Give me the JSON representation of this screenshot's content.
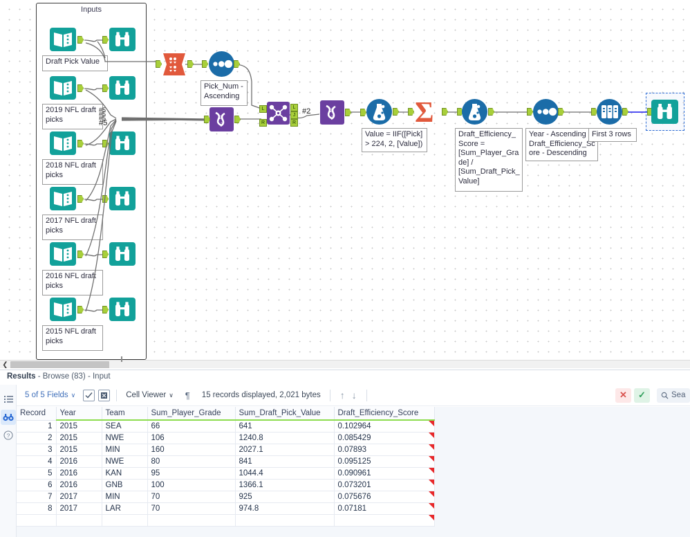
{
  "canvas": {
    "container_title": "Inputs",
    "input_labels": [
      "Draft Pick Value",
      "2019 NFL draft picks",
      "2018 NFL draft picks",
      "2017 NFL draft picks",
      "2016 NFL draft picks",
      "2015 NFL draft picks"
    ],
    "annotations": {
      "sort_pick_num": "Pick_Num - Ascending",
      "formula_value": "Value = IIF([Pick] > 224, 2, [Value])",
      "formula_efficiency": "Draft_Efficiency_Score = [Sum_Player_Grade] / [Sum_Draft_Pick_Value]",
      "sort_year_score": "Year - Ascending\nDraft_Efficiency_Score - Descending",
      "sample_rows": "First 3 rows"
    },
    "connection_labels": {
      "union_multi": "#5",
      "join_out": "#2"
    },
    "join_anchors": [
      "L",
      "J",
      "R"
    ],
    "colors": {
      "input_teal": "#12a19a",
      "browse_teal": "#12a19a",
      "transpose_orange": "#e1593c",
      "sort_blue": "#1b6ca8",
      "join_purple": "#6b3fa0",
      "select_purple": "#6b3fa0",
      "summarize_orange": "#e1593c",
      "formula_blue": "#1b6ca8",
      "sample_blue": "#1b6ca8",
      "anchor_green": "#a8cf3a",
      "selection_blue": "#2a6ad4"
    }
  },
  "results": {
    "title_prefix": "Results",
    "title_suffix": " - Browse (83) - Input",
    "rail_icons": [
      "list-icon",
      "browse-binoculars-icon",
      "help-icon"
    ],
    "toolbar": {
      "fields": "5 of 5 Fields",
      "chevron": "∨",
      "select_all_icon": "checkbox-check-icon",
      "deselect_all_icon": "checkbox-x-icon",
      "cell_viewer": "Cell Viewer",
      "pilcrow": "¶",
      "record_info": "15 records displayed, 2,021 bytes",
      "up_arrow": "↑",
      "down_arrow": "↓",
      "close_label": "✕",
      "check_label": "✓",
      "search_placeholder": "Sea"
    },
    "grid": {
      "columns": [
        "Record",
        "Year",
        "Team",
        "Sum_Player_Grade",
        "Sum_Draft_Pick_Value",
        "Draft_Efficiency_Score"
      ],
      "rows": [
        {
          "record": "1",
          "year": "2015",
          "team": "SEA",
          "grade": "66",
          "pick_value": "641",
          "score": "0.102964"
        },
        {
          "record": "2",
          "year": "2015",
          "team": "NWE",
          "grade": "106",
          "pick_value": "1240.8",
          "score": "0.085429"
        },
        {
          "record": "3",
          "year": "2015",
          "team": "MIN",
          "grade": "160",
          "pick_value": "2027.1",
          "score": "0.07893"
        },
        {
          "record": "4",
          "year": "2016",
          "team": "NWE",
          "grade": "80",
          "pick_value": "841",
          "score": "0.095125"
        },
        {
          "record": "5",
          "year": "2016",
          "team": "KAN",
          "grade": "95",
          "pick_value": "1044.4",
          "score": "0.090961"
        },
        {
          "record": "6",
          "year": "2016",
          "team": "GNB",
          "grade": "100",
          "pick_value": "1366.1",
          "score": "0.073201"
        },
        {
          "record": "7",
          "year": "2017",
          "team": "MIN",
          "grade": "70",
          "pick_value": "925",
          "score": "0.075676"
        },
        {
          "record": "8",
          "year": "2017",
          "team": "LAR",
          "grade": "70",
          "pick_value": "974.8",
          "score": "0.07181"
        },
        {
          "record": "",
          "year": "",
          "team": "",
          "grade": "",
          "pick_value": "",
          "score": ""
        }
      ]
    }
  }
}
